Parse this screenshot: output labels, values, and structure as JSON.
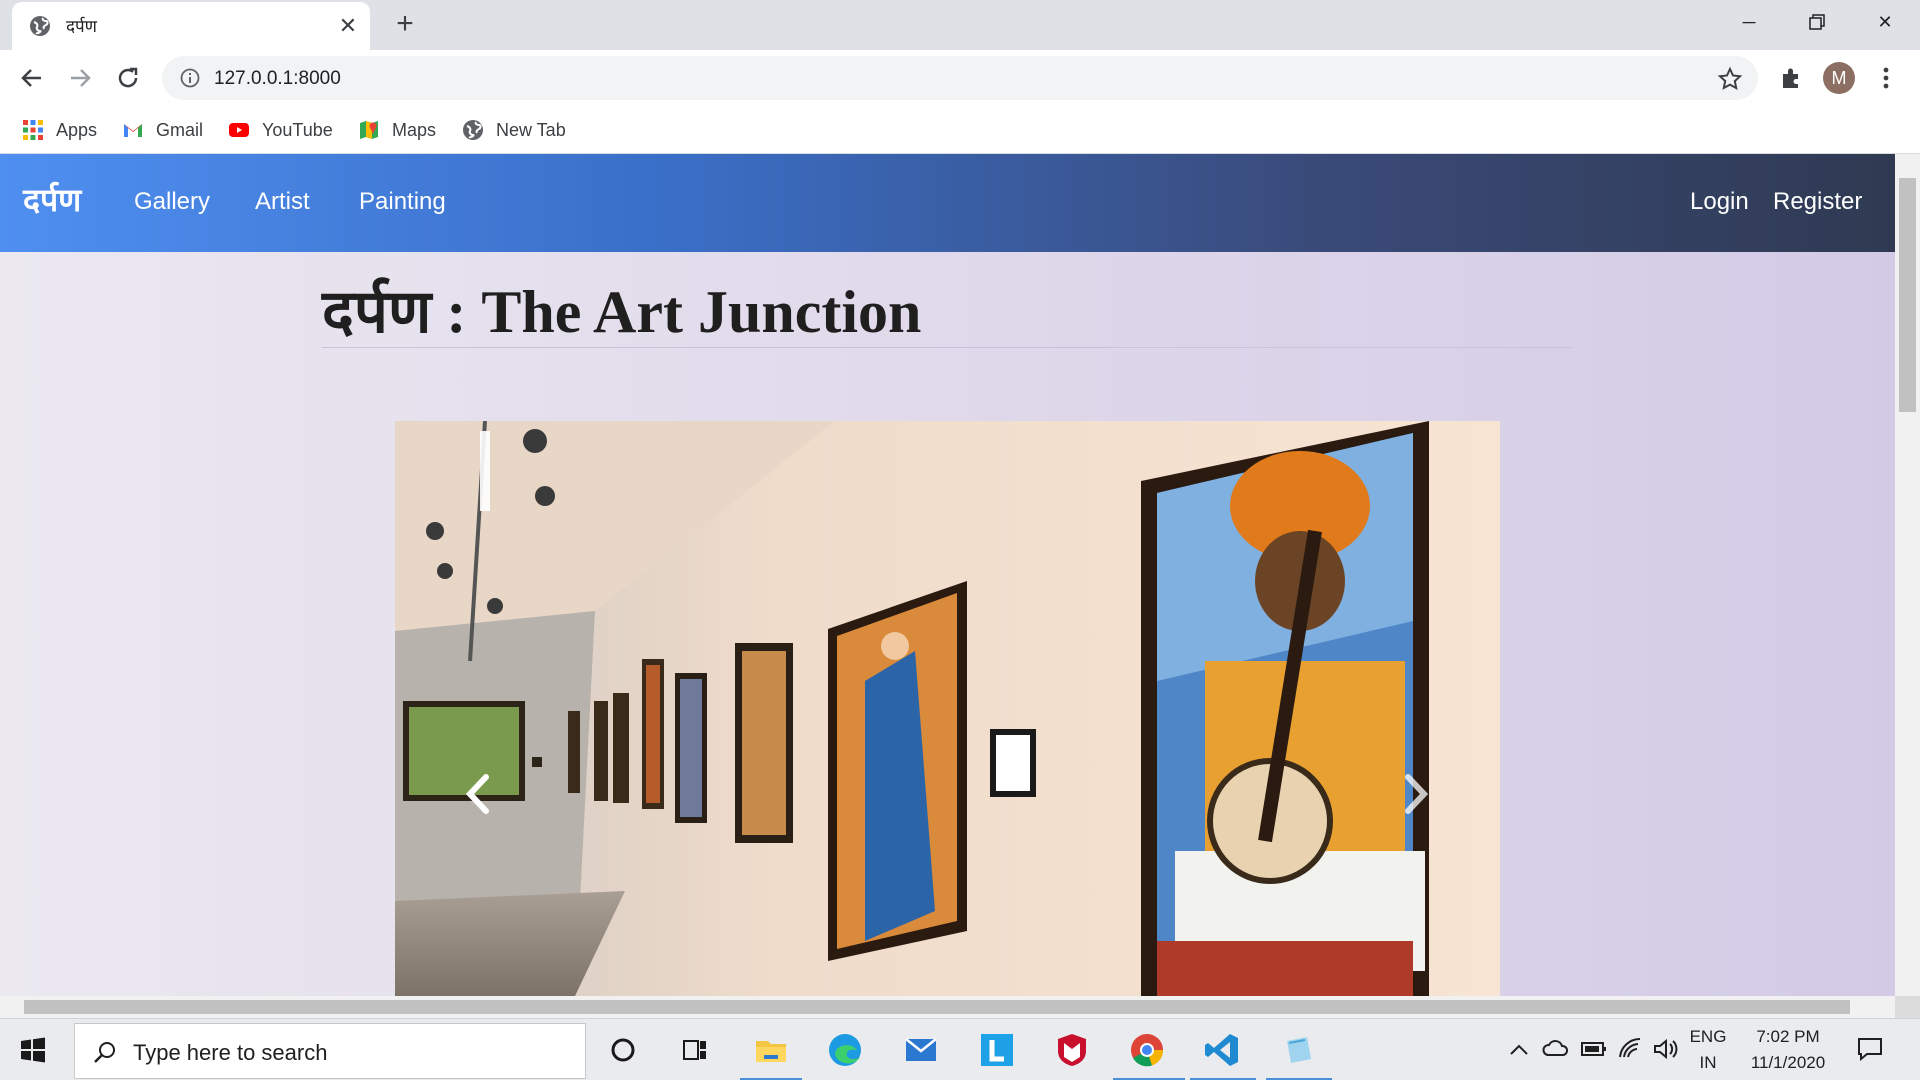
{
  "browser": {
    "tab_title": "दर्पण",
    "url": "127.0.0.1:8000",
    "profile_initial": "M",
    "bookmarks": [
      {
        "label": "Apps",
        "icon": "apps-grid-icon"
      },
      {
        "label": "Gmail",
        "icon": "gmail-icon"
      },
      {
        "label": "YouTube",
        "icon": "youtube-icon"
      },
      {
        "label": "Maps",
        "icon": "maps-icon"
      },
      {
        "label": "New Tab",
        "icon": "globe-icon"
      }
    ]
  },
  "site": {
    "brand": "दर्पण",
    "nav_left": [
      "Gallery",
      "Artist",
      "Painting"
    ],
    "nav_right": [
      "Login",
      "Register"
    ],
    "heading_devanagari": "दर्पण",
    "heading_separator": " : ",
    "heading_english": "The Art Junction",
    "carousel": {
      "image_description_icon": "gallery-photo",
      "prev_icon": "chevron-left-icon",
      "next_icon": "chevron-right-icon"
    }
  },
  "taskbar": {
    "search_placeholder": "Type here to search",
    "language": "ENG",
    "region": "IN",
    "time": "7:02 PM",
    "date": "11/1/2020"
  },
  "colors": {
    "navbar_start": "#4f8ff0",
    "navbar_end": "#2f3a52",
    "page_bg": "#ddd6ea"
  }
}
